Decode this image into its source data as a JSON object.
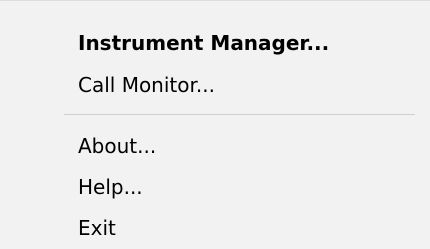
{
  "menu": {
    "items": [
      {
        "label": "Instrument Manager...",
        "default": true
      },
      {
        "label": "Call Monitor..."
      },
      {
        "label": "About..."
      },
      {
        "label": "Help..."
      },
      {
        "label": "Exit"
      }
    ]
  },
  "colors": {
    "menu_background": "#f2f2f2",
    "separator": "#cfcfcf",
    "text": "#000000"
  }
}
